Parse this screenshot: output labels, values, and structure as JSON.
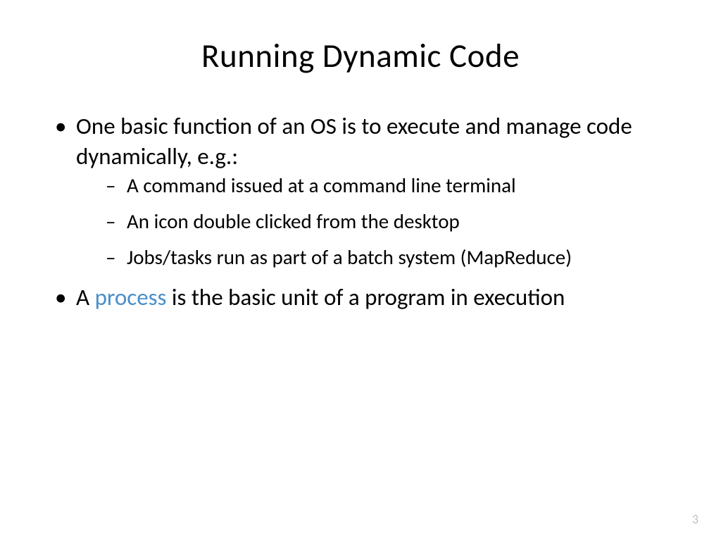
{
  "slide": {
    "title": "Running Dynamic Code",
    "bullets": [
      {
        "text_pre": "One basic function of an OS is to execute and manage code dynamically, e.g.:",
        "sub": [
          "A command issued at a command line terminal",
          "An icon double clicked from the desktop",
          "Jobs/tasks run as part of a batch system (MapReduce)"
        ]
      },
      {
        "text_pre": "A ",
        "highlight": "process",
        "text_post": " is the basic unit of a program in execution"
      }
    ],
    "page_number": "3"
  },
  "colors": {
    "highlight": "#4a8fc9",
    "page_number": "#bfbfbf"
  }
}
